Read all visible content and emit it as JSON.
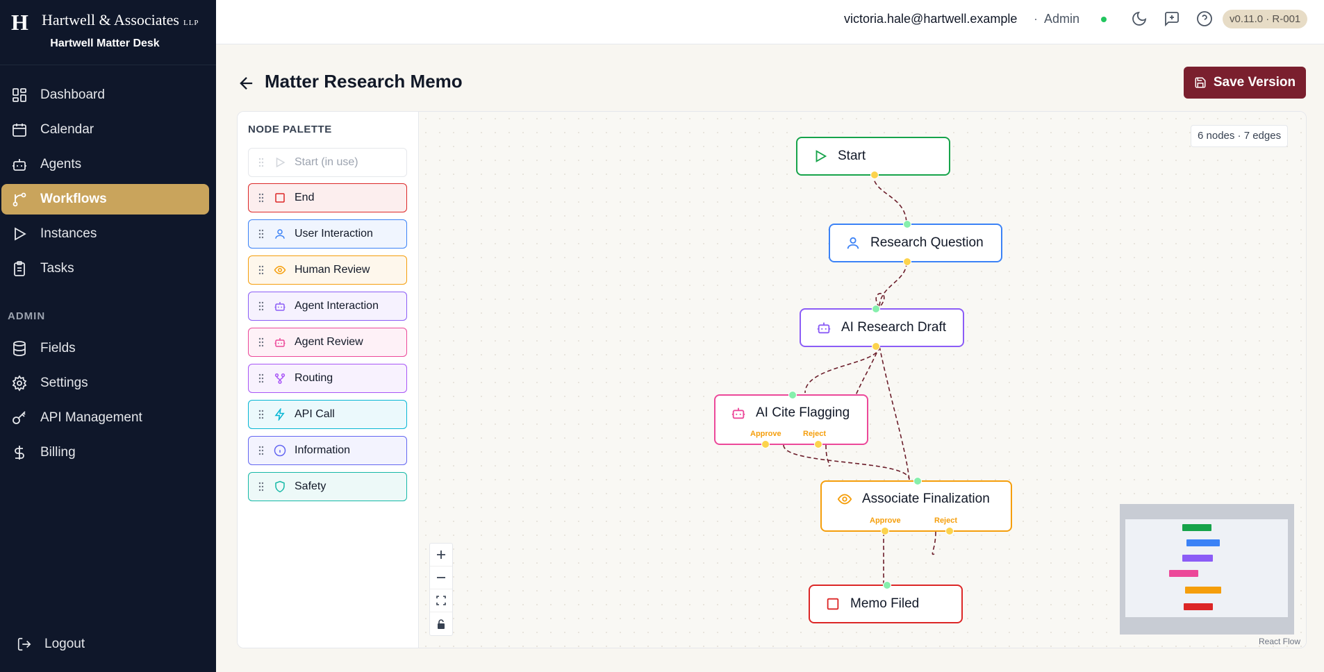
{
  "brand": {
    "logo": "H",
    "name": "Hartwell & Associates",
    "suffix": "LLP",
    "app_name": "Hartwell Matter Desk"
  },
  "nav": {
    "main": [
      {
        "label": "Dashboard",
        "icon": "dashboard-icon"
      },
      {
        "label": "Calendar",
        "icon": "calendar-icon"
      },
      {
        "label": "Agents",
        "icon": "bot-icon"
      },
      {
        "label": "Workflows",
        "icon": "workflow-icon",
        "active": true
      },
      {
        "label": "Instances",
        "icon": "play-icon"
      },
      {
        "label": "Tasks",
        "icon": "clipboard-icon"
      }
    ],
    "admin_heading": "ADMIN",
    "admin": [
      {
        "label": "Fields",
        "icon": "database-icon"
      },
      {
        "label": "Settings",
        "icon": "gear-icon"
      },
      {
        "label": "API Management",
        "icon": "key-icon"
      },
      {
        "label": "Billing",
        "icon": "dollar-icon"
      }
    ],
    "logout": "Logout"
  },
  "topbar": {
    "email": "victoria.hale@hartwell.example",
    "separator": "·",
    "role": "Admin",
    "version": "v0.11.0 · R-001"
  },
  "page": {
    "title": "Matter Research Memo",
    "save_label": "Save Version"
  },
  "palette": {
    "title": "NODE PALETTE",
    "items": [
      {
        "label": "Start (in use)",
        "icon": "play-icon",
        "color": "#d1d5db",
        "disabled": true
      },
      {
        "label": "End",
        "icon": "square-icon",
        "color": "#dc2626"
      },
      {
        "label": "User Interaction",
        "icon": "user-icon",
        "color": "#3b82f6"
      },
      {
        "label": "Human Review",
        "icon": "eye-icon",
        "color": "#f59e0b"
      },
      {
        "label": "Agent Interaction",
        "icon": "bot-icon",
        "color": "#8b5cf6"
      },
      {
        "label": "Agent Review",
        "icon": "bot-icon",
        "color": "#ec4899"
      },
      {
        "label": "Routing",
        "icon": "routing-icon",
        "color": "#a855f7"
      },
      {
        "label": "API Call",
        "icon": "bolt-icon",
        "color": "#06b6d4"
      },
      {
        "label": "Information",
        "icon": "info-icon",
        "color": "#6366f1"
      },
      {
        "label": "Safety",
        "icon": "shield-icon",
        "color": "#14b8a6"
      }
    ]
  },
  "canvas": {
    "count_label": "6 nodes · 7 edges",
    "nodes": [
      {
        "label": "Start",
        "icon": "play-icon",
        "color": "#16a34a"
      },
      {
        "label": "Research Question",
        "icon": "user-icon",
        "color": "#3b82f6"
      },
      {
        "label": "AI Research Draft",
        "icon": "bot-icon",
        "color": "#8b5cf6"
      },
      {
        "label": "AI Cite Flagging",
        "icon": "bot-icon",
        "color": "#ec4899",
        "outputs": [
          "Approve",
          "Reject"
        ]
      },
      {
        "label": "Associate Finalization",
        "icon": "eye-icon",
        "color": "#f59e0b",
        "outputs": [
          "Approve",
          "Reject"
        ]
      },
      {
        "label": "Memo Filed",
        "icon": "square-icon",
        "color": "#dc2626"
      }
    ],
    "edge_color": "#6b1d2a",
    "attribution": "React Flow"
  }
}
